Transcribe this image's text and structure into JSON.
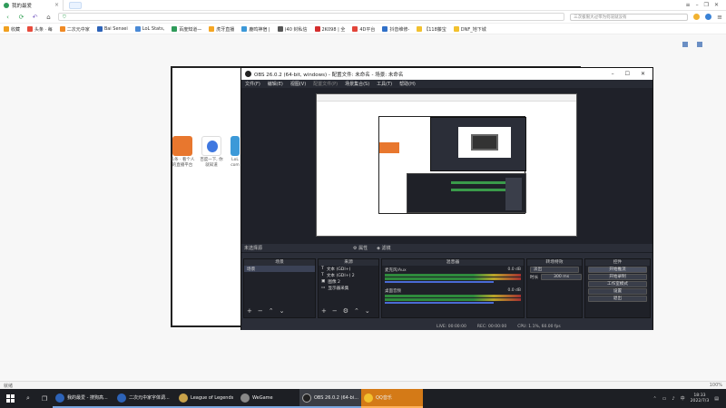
{
  "browser": {
    "tab_title": "我的最爱",
    "search_placeholder": "三次极限大过带为何况就没有",
    "address": "",
    "bookmarks": [
      "收藏",
      "头条 · 每",
      "二次元中家",
      "Bai Sensei",
      "LoL Stats,",
      "百度知道—",
      "虎牙直播",
      "鹿鸣神宿 |",
      "(40 封私信",
      "2K098 | 全",
      "4D平台",
      "抖音维修-",
      "【118藤宝",
      "DNF_地下城"
    ],
    "status_left": "就绪",
    "status_right": "100%"
  },
  "desktop_tiles": [
    {
      "label": "头条 · 看个人\n的直播平台",
      "color": "#e8772e"
    },
    {
      "label": "百度一下, 你\n就知道",
      "color": "#3f78e0"
    },
    {
      "label": "LoL\ncom",
      "color": "#3c99d8"
    }
  ],
  "obs": {
    "title": "OBS 26.0.2 (64-bit, windows) - 配置文件: 未命名 - 场景: 未命名",
    "menu": [
      "文件(F)",
      "编辑(E)",
      "视图(V)",
      "配置文件(P)",
      "场景集合(S)",
      "工具(T)",
      "帮助(H)"
    ],
    "scene_bar": {
      "label": "未选择源",
      "properties": "属性",
      "filters": "滤镜"
    },
    "docks": {
      "scenes": {
        "title": "场景",
        "items": [
          "场景"
        ]
      },
      "sources": {
        "title": "来源",
        "items": [
          "文本 (GDI+)",
          "文本 (GDI+) 2",
          "图像 2",
          "显示器采集"
        ]
      },
      "mixer": {
        "title": "混音器",
        "channels": [
          {
            "name": "麦克风/Aux",
            "db": "0.0 dB"
          },
          {
            "name": "桌面音频",
            "db": "0.0 dB"
          }
        ]
      },
      "transitions": {
        "title": "转场特效",
        "mode": "淡出",
        "duration_label": "时长",
        "duration": "300 ms"
      },
      "controls": {
        "title": "控件",
        "buttons": [
          "开始推流",
          "开始录制",
          "工作室模式",
          "设置",
          "退出"
        ]
      }
    },
    "statusbar": [
      "LIVE: 00:00:00",
      "REC: 00:00:00",
      "CPU: 1.1%, 60.00 fps"
    ]
  },
  "taskbar": {
    "apps": [
      "我的最爱 - 搜狗高...",
      "二次元中家字体调...",
      "League of Legends",
      "WeGame",
      "OBS 26.0.2 (64-bi...",
      "QQ音乐"
    ],
    "time": "18:33",
    "date": "2022/7/3"
  }
}
